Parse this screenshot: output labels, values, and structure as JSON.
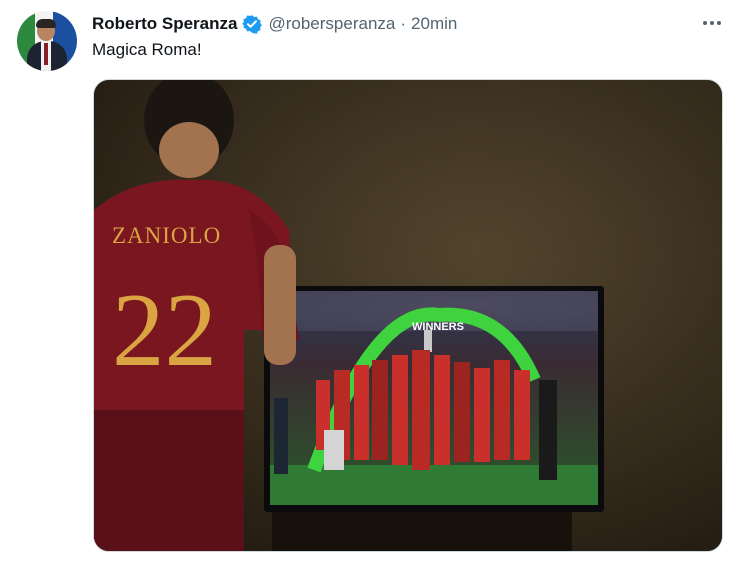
{
  "tweet": {
    "author_name": "Roberto Speranza",
    "handle": "@robersperanza",
    "separator": "·",
    "time": "20min",
    "text": "Magica Roma!"
  },
  "media": {
    "jersey_name": "ZANIOLO",
    "jersey_number": "22",
    "tv_banner": "WINNERS"
  },
  "colors": {
    "verified": "#1d9bf0",
    "text_primary": "#0f1419",
    "text_secondary": "#536471",
    "roma_red": "#8a1620",
    "jersey_gold": "#d9a441"
  },
  "icons": [
    "verified-badge-icon",
    "more-options-icon"
  ]
}
